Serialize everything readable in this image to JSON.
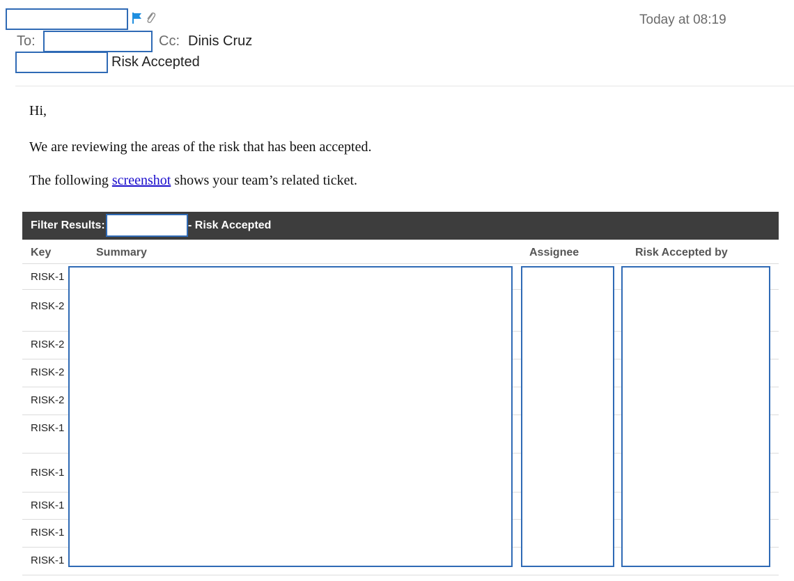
{
  "header": {
    "time": "Today at 08:19",
    "to_label": "To:",
    "cc_label": "Cc:",
    "cc_name": "Dinis Cruz",
    "subject": "Risk Accepted"
  },
  "body": {
    "greeting": "Hi,",
    "line1": "We are reviewing the areas of the risk that has been accepted.",
    "line2_prefix": "The following ",
    "link_text": "screenshot",
    "line2_suffix": " shows your team’s related ticket."
  },
  "table": {
    "filter_label": "Filter Results:",
    "filter_suffix": "- Risk Accepted",
    "columns": [
      "Key",
      "Summary",
      "Assignee",
      "Risk Accepted by"
    ],
    "rows": [
      "RISK-1",
      "RISK-2",
      "RISK-2",
      "RISK-2",
      "RISK-2",
      "RISK-1",
      "RISK-1",
      "RISK-1",
      "RISK-1",
      "RISK-1"
    ]
  },
  "icons": {
    "flag_color": "#1f8fe0",
    "redaction_border": "#2f6ab5"
  }
}
